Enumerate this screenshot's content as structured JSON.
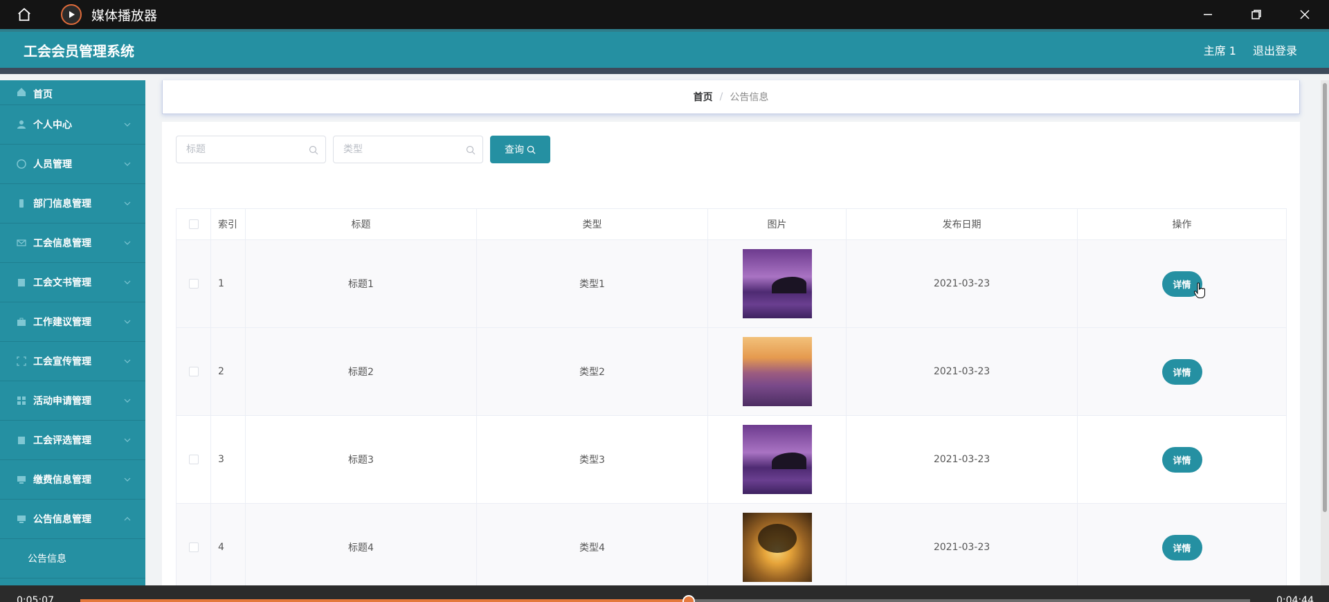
{
  "player": {
    "app_name": "媒体播放器",
    "time_elapsed": "0:05:07",
    "time_total": "0:04:44",
    "progress_fraction": 0.52
  },
  "header": {
    "system_title": "工会会员管理系统",
    "user_label": "主席 1",
    "logout_label": "退出登录"
  },
  "sidebar": {
    "items": [
      {
        "label": "首页",
        "icon": "home-icon"
      },
      {
        "label": "个人中心",
        "icon": "user-icon"
      },
      {
        "label": "人员管理",
        "icon": "people-icon"
      },
      {
        "label": "部门信息管理",
        "icon": "phone-icon"
      },
      {
        "label": "工会信息管理",
        "icon": "mail-icon"
      },
      {
        "label": "工会文书管理",
        "icon": "clipboard-icon"
      },
      {
        "label": "工作建议管理",
        "icon": "briefcase-icon"
      },
      {
        "label": "工会宣传管理",
        "icon": "frame-icon"
      },
      {
        "label": "活动申请管理",
        "icon": "grid-icon"
      },
      {
        "label": "工会评选管理",
        "icon": "clipboard-icon"
      },
      {
        "label": "缴费信息管理",
        "icon": "monitor-icon"
      },
      {
        "label": "公告信息管理",
        "icon": "monitor-icon"
      }
    ],
    "sub_item": "公告信息"
  },
  "breadcrumb": {
    "home": "首页",
    "separator": "/",
    "current": "公告信息"
  },
  "search": {
    "title_placeholder": "标题",
    "type_placeholder": "类型",
    "query_label": "查询"
  },
  "table": {
    "headers": {
      "index": "索引",
      "title": "标题",
      "type": "类型",
      "image": "图片",
      "date": "发布日期",
      "action": "操作"
    },
    "rows": [
      {
        "index": "1",
        "title": "标题1",
        "type": "类型1",
        "image": "purple-sea-island",
        "date": "2021-03-23",
        "action": "详情"
      },
      {
        "index": "2",
        "title": "标题2",
        "type": "类型2",
        "image": "lavender-sunset",
        "date": "2021-03-23",
        "action": "详情"
      },
      {
        "index": "3",
        "title": "标题3",
        "type": "类型3",
        "image": "purple-sea-island",
        "date": "2021-03-23",
        "action": "详情"
      },
      {
        "index": "4",
        "title": "标题4",
        "type": "类型4",
        "image": "golden-tree",
        "date": "2021-03-23",
        "action": "详情"
      }
    ]
  },
  "colors": {
    "accent": "#2590a2",
    "header_border": "#3d4a5b",
    "player_progress": "#e4793c"
  }
}
